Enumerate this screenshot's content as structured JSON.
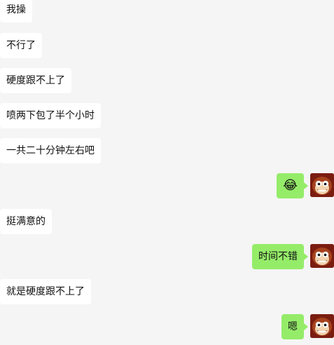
{
  "messages": [
    {
      "side": "in",
      "text": "我操"
    },
    {
      "side": "in",
      "text": "不行了"
    },
    {
      "side": "in",
      "text": "硬度跟不上了"
    },
    {
      "side": "in",
      "text": "喷两下包了半个小时"
    },
    {
      "side": "in",
      "text": "一共二十分钟左右吧"
    },
    {
      "side": "out",
      "text": "😂"
    },
    {
      "side": "in",
      "text": "挺满意的"
    },
    {
      "side": "out",
      "text": "时间不错"
    },
    {
      "side": "in",
      "text": "就是硬度跟不上了"
    },
    {
      "side": "out",
      "text": "嗯"
    }
  ],
  "colors": {
    "background": "#f5f5f5",
    "incoming_bubble": "#ffffff",
    "outgoing_bubble": "#95ec69",
    "avatar": "#7a1d10"
  },
  "icons": {
    "avatar": "monkey-avatar-icon"
  }
}
